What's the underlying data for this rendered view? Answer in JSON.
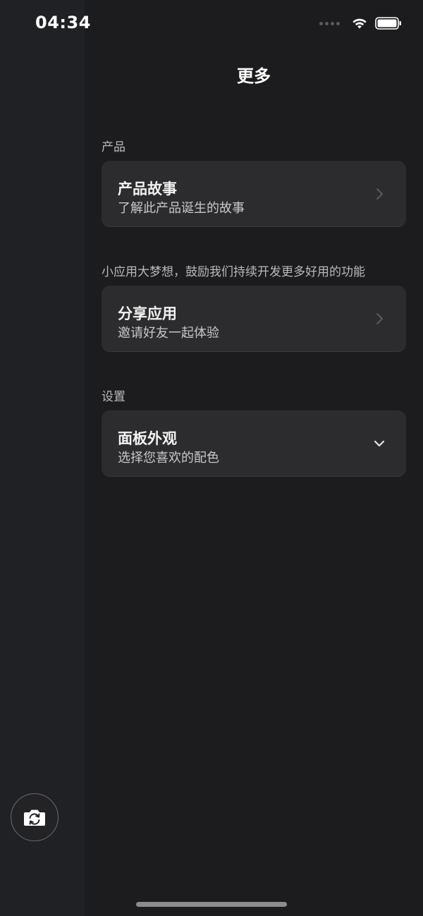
{
  "status_bar": {
    "time": "04:34"
  },
  "header": {
    "title": "更多"
  },
  "sections": [
    {
      "label": "产品",
      "card": {
        "title": "产品故事",
        "subtitle": "了解此产品诞生的故事",
        "icon": "chevron-right-icon"
      }
    },
    {
      "label": "小应用大梦想，鼓励我们持续开发更多好用的功能",
      "card": {
        "title": "分享应用",
        "subtitle": "邀请好友一起体验",
        "icon": "chevron-right-icon"
      }
    },
    {
      "label": "设置",
      "card": {
        "title": "面板外观",
        "subtitle": "选择您喜欢的配色",
        "icon": "chevron-down-icon"
      }
    }
  ],
  "floating_button": {
    "icon": "camera-switch-icon"
  },
  "colors": {
    "background": "#1c1c1e",
    "left_rail": "#202124",
    "card": "#2c2c2e",
    "text_primary": "#ffffff",
    "text_secondary": "#c8c8cc"
  }
}
